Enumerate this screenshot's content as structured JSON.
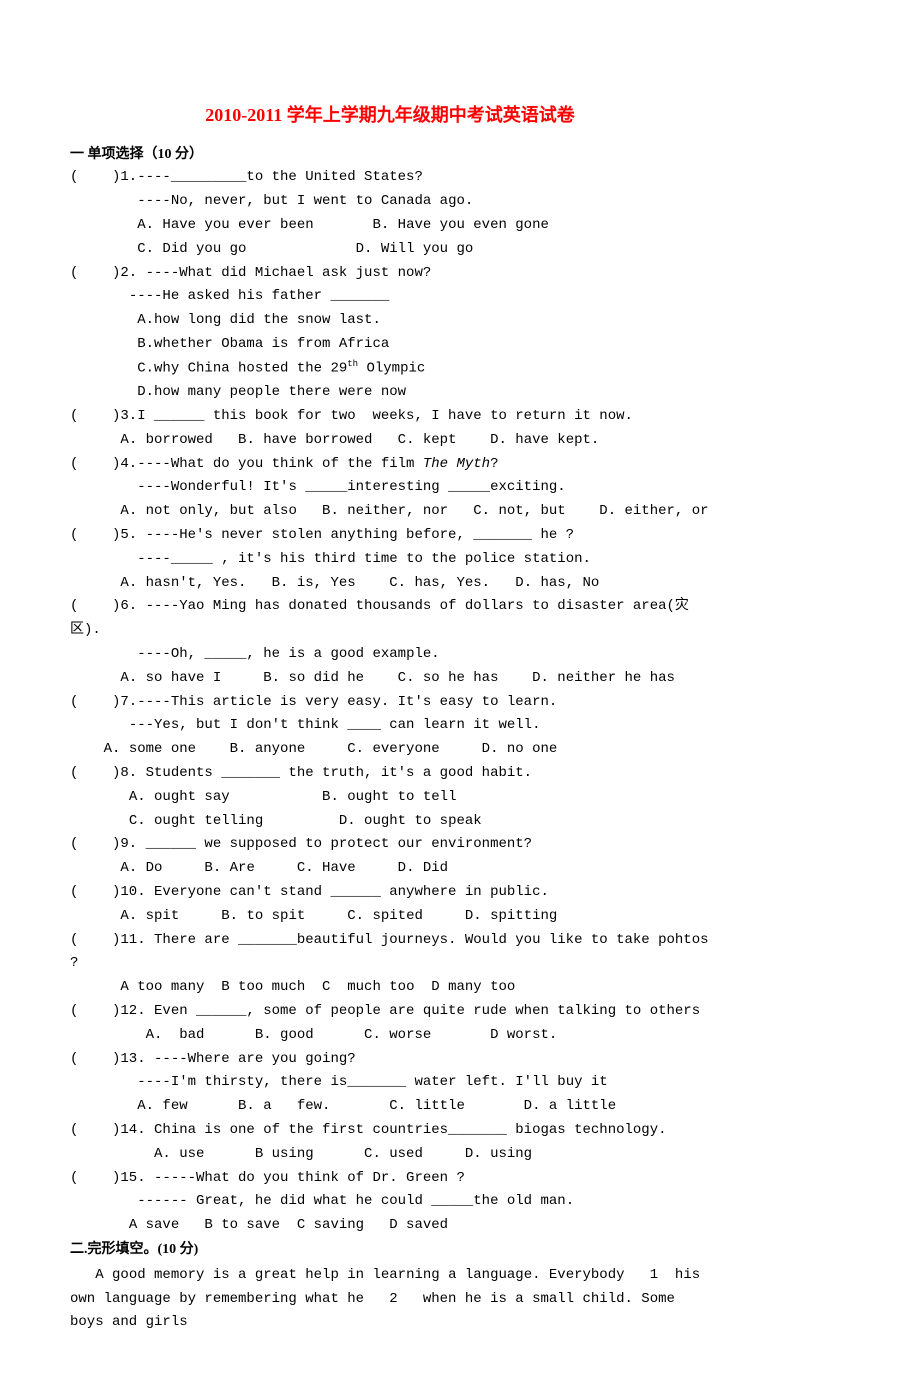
{
  "title": "2010-2011 学年上学期九年级期中考试英语试卷",
  "section1": {
    "header": "一 单项选择（10 分）",
    "q1": {
      "l1": "(    )1.----_________to the United States?",
      "l2": "        ----No, never, but I went to Canada ago.",
      "l3": "        A. Have you ever been       B. Have you even gone",
      "l4": "        C. Did you go             D. Will you go"
    },
    "q2": {
      "l1": "(    )2. ----What did Michael ask just now?",
      "l2": "       ----He asked his father _______",
      "l3": "        A.how long did the snow last.",
      "l4": "        B.whether Obama is from Africa",
      "l5_pre": "        C.why China hosted the 29",
      "l5_sup": "th",
      "l5_post": " Olympic",
      "l6": "        D.how many people there were now"
    },
    "q3": {
      "l1": "(    )3.I ______ this book for two  weeks, I have to return it now.",
      "l2": "      A. borrowed   B. have borrowed   C. kept    D. have kept."
    },
    "q4": {
      "l1_pre": "(    )4.----What do you think of the film ",
      "l1_it": "The Myth",
      "l1_post": "?",
      "l2": "        ----Wonderful! It's _____interesting _____exciting.",
      "l3": "      A. not only, but also   B. neither, nor   C. not, but    D. either, or"
    },
    "q5": {
      "l1": "(    )5. ----He's never stolen anything before, _______ he ?",
      "l2": "        ----_____ , it's his third time to the police station.",
      "l3": "      A. hasn't, Yes.   B. is, Yes    C. has, Yes.   D. has, No"
    },
    "q6": {
      "l1": "(    )6. ----Yao Ming has donated thousands of dollars to disaster area(灾区).",
      "l2": "        ----Oh, _____, he is a good example.",
      "l3": "      A. so have I     B. so did he    C. so he has    D. neither he has"
    },
    "q7": {
      "l1": "(    )7.----This article is very easy. It's easy to learn.",
      "l2": "       ---Yes, but I don't think ____ can learn it well.",
      "l3": "    A. some one    B. anyone     C. everyone     D. no one"
    },
    "q8": {
      "l1": "(    )8. Students _______ the truth, it's a good habit.",
      "l2": "       A. ought say           B. ought to tell",
      "l3": "       C. ought telling         D. ought to speak"
    },
    "q9": {
      "l1": "(    )9. ______ we supposed to protect our environment?",
      "l2": "      A. Do     B. Are     C. Have     D. Did"
    },
    "q10": {
      "l1": "(    )10. Everyone can't stand ______ anywhere in public.",
      "l2": "      A. spit     B. to spit     C. spited     D. spitting"
    },
    "q11": {
      "l1": "(    )11. There are _______beautiful journeys. Would you like to take pohtos ?",
      "l2": "      A too many  B too much  C  much too  D many too"
    },
    "q12": {
      "l1": "(    )12. Even ______, some of people are quite rude when talking to others",
      "l2": "         A.  bad      B. good      C. worse       D worst."
    },
    "q13": {
      "l1": "(    )13. ----Where are you going?",
      "l2": "        ----I'm thirsty, there is_______ water left. I'll buy it",
      "l3": "        A. few      B. a   few.       C. little       D. a little"
    },
    "q14": {
      "l1": "(    )14. China is one of the first countries_______ biogas technology.",
      "l2": "          A. use      B using      C. used     D. using"
    },
    "q15": {
      "l1": "(    )15. -----What do you think of Dr. Green ?",
      "l2": "        ------ Great, he did what he could _____the old man.",
      "l3": "       A save   B to save  C saving   D saved"
    }
  },
  "section2": {
    "header": "二.完形填空。(10 分)",
    "p1": "   A good memory is a great help in learning a language. Everybody   1  his own language by remembering what he   2   when he is a small child. Some boys and girls"
  }
}
